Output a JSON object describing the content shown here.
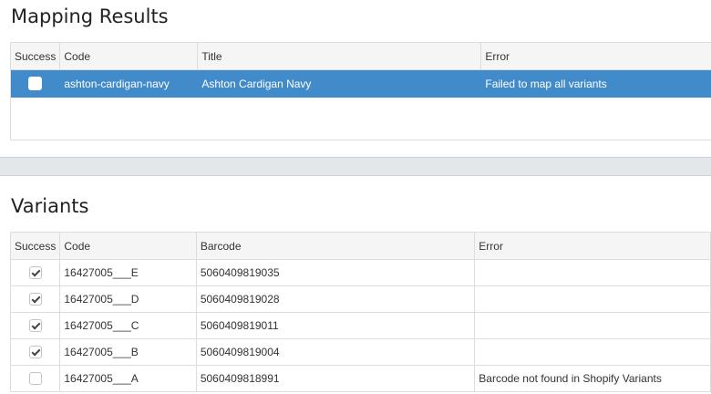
{
  "mapping_results": {
    "title": "Mapping Results",
    "columns": [
      "Success",
      "Code",
      "Title",
      "Error"
    ],
    "rows": [
      {
        "success": false,
        "code": "ashton-cardigan-navy",
        "title": "Ashton Cardigan Navy",
        "error": "Failed to map all variants",
        "selected": true
      }
    ]
  },
  "variants": {
    "title": "Variants",
    "columns": [
      "Success",
      "Code",
      "Barcode",
      "Error"
    ],
    "rows": [
      {
        "success": true,
        "code": "16427005___E",
        "barcode": "5060409819035",
        "error": ""
      },
      {
        "success": true,
        "code": "16427005___D",
        "barcode": "5060409819028",
        "error": ""
      },
      {
        "success": true,
        "code": "16427005___C",
        "barcode": "5060409819011",
        "error": ""
      },
      {
        "success": true,
        "code": "16427005___B",
        "barcode": "5060409819004",
        "error": ""
      },
      {
        "success": false,
        "code": "16427005___A",
        "barcode": "5060409818991",
        "error": "Barcode not found in Shopify Variants"
      }
    ]
  },
  "colors": {
    "selected_row": "#428bca",
    "header_bg": "#f5f5f5",
    "divider_bar": "#e4e7ea"
  }
}
